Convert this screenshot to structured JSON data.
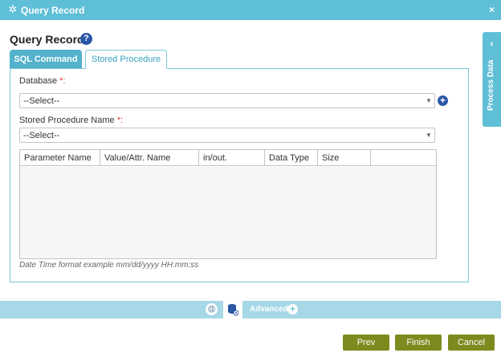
{
  "window": {
    "title": "Query Record",
    "close_glyph": "×",
    "icon": "gear-icon"
  },
  "heading": {
    "title": "Query Record",
    "help_glyph": "?"
  },
  "tabs": [
    {
      "label": "SQL Command",
      "active": false
    },
    {
      "label": "Stored Procedure",
      "active": true
    }
  ],
  "form": {
    "database": {
      "label": "Database",
      "required_mark": "*:",
      "value": "--Select--",
      "add_glyph": "+"
    },
    "stored_procedure": {
      "label": "Stored Procedure Name",
      "required_mark": "*:",
      "value": "--Select--"
    }
  },
  "grid": {
    "columns": [
      "Parameter Name",
      "Value/Attr. Name",
      "in/out.",
      "Data Type",
      "Size"
    ],
    "rows": []
  },
  "hint": "Date Time format example mm/dd/yyyy HH:mm:ss",
  "side_panel": {
    "label": "Process Data",
    "chevron": "‹"
  },
  "toolbar": {
    "advanced_label": "Advanced",
    "advanced_plus": "+"
  },
  "buttons": {
    "prev": "Prev",
    "finish": "Finish",
    "cancel": "Cancel"
  },
  "colors": {
    "titlebar": "#5fbfd7",
    "accent_blue": "#2a56a6",
    "button_olive": "#7d8a1e",
    "required_red": "#e03b3b",
    "toolbar": "#a6d8e7"
  }
}
